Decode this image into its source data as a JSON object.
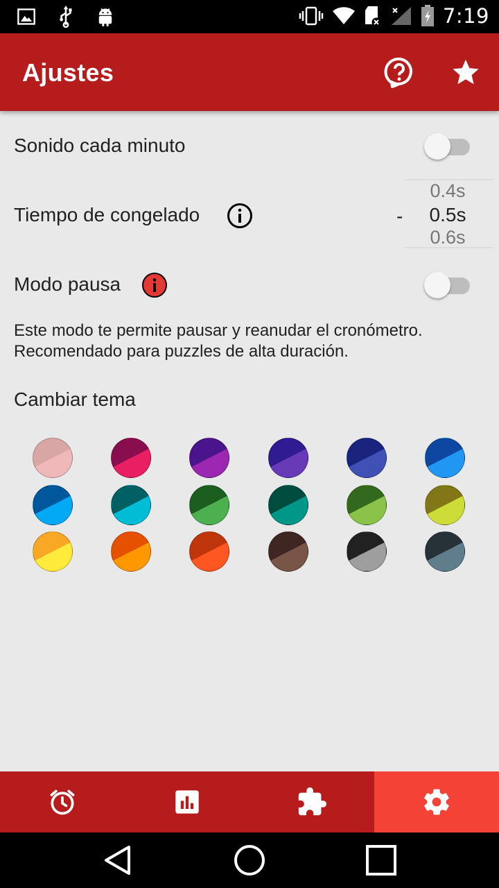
{
  "status_bar": {
    "time": "7:19",
    "left_icons": [
      "image-icon",
      "usb-icon",
      "android-icon"
    ],
    "right_icons": [
      "vibrate-icon",
      "wifi-icon",
      "sd-card-icon",
      "signal-icon",
      "battery-icon"
    ]
  },
  "appbar": {
    "title": "Ajustes",
    "actions": [
      "help-icon",
      "star-icon"
    ],
    "color": "#b71c1c"
  },
  "settings": {
    "sound_label": "Sonido cada minuto",
    "sound_enabled": false,
    "freeze_label": "Tiempo de congelado",
    "freeze_dash": "-",
    "freeze_values": [
      "0.4s",
      "0.5s",
      "0.6s"
    ],
    "freeze_selected": "0.5s",
    "pause_label": "Modo pausa",
    "pause_enabled": false,
    "pause_description": "Este modo te permite pausar y reanudar el cronómetro. Recomendado para puzzles de alta duración.",
    "theme_label": "Cambiar tema"
  },
  "themes": [
    {
      "dark": "#d9a6a6",
      "light": "#f0b9b9"
    },
    {
      "dark": "#880e4f",
      "light": "#e91e63"
    },
    {
      "dark": "#4a148c",
      "light": "#9c27b0"
    },
    {
      "dark": "#311b92",
      "light": "#673ab7"
    },
    {
      "dark": "#1a237e",
      "light": "#3f51b5"
    },
    {
      "dark": "#0d47a1",
      "light": "#2196f3"
    },
    {
      "dark": "#01579b",
      "light": "#03a9f4"
    },
    {
      "dark": "#006064",
      "light": "#00bcd4"
    },
    {
      "dark": "#1b5e20",
      "light": "#4caf50"
    },
    {
      "dark": "#004d40",
      "light": "#009688"
    },
    {
      "dark": "#33691e",
      "light": "#8bc34a"
    },
    {
      "dark": "#827717",
      "light": "#cddc39"
    },
    {
      "dark": "#f9a825",
      "light": "#ffeb3b"
    },
    {
      "dark": "#e65100",
      "light": "#ff9800"
    },
    {
      "dark": "#bf360c",
      "light": "#ff5722"
    },
    {
      "dark": "#3e2723",
      "light": "#795548"
    },
    {
      "dark": "#212121",
      "light": "#9e9e9e"
    },
    {
      "dark": "#263238",
      "light": "#607d8b"
    }
  ],
  "bottom_nav": [
    {
      "icon": "alarm-clock-icon",
      "active": false
    },
    {
      "icon": "stats-icon",
      "active": false
    },
    {
      "icon": "puzzle-icon",
      "active": false
    },
    {
      "icon": "gear-icon",
      "active": true
    }
  ],
  "system_nav": [
    "back-icon",
    "home-icon",
    "recents-icon"
  ]
}
